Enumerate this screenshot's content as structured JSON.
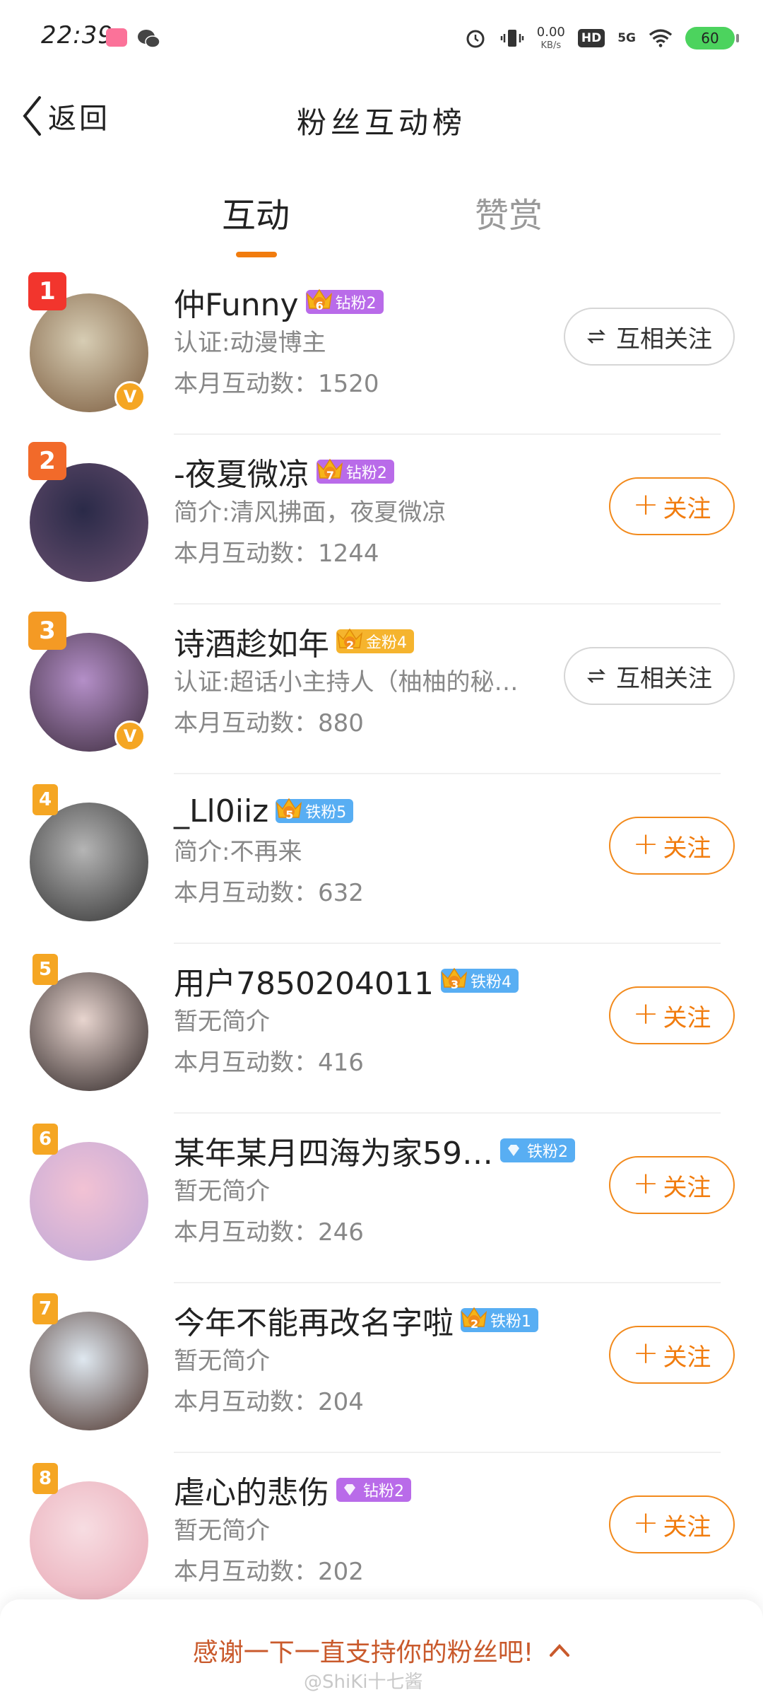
{
  "status_bar": {
    "time": "22:39",
    "net_speed_value": "0.00",
    "net_speed_unit": "KB/s",
    "hd": "HD",
    "signal": "5G",
    "battery": "60"
  },
  "header": {
    "back_label": "返回",
    "title": "粉丝互动榜"
  },
  "tabs": [
    {
      "label": "互动",
      "active": true
    },
    {
      "label": "赞赏",
      "active": false
    }
  ],
  "fans": [
    {
      "rank": "1",
      "name": "仲Funny",
      "badge_level": "6",
      "badge_label": "钻粉2",
      "badge_color": "#b96be9",
      "desc": "认证:动漫博主",
      "count": "本月互动数：1520",
      "button": "互相关注",
      "button_type": "mutual",
      "verified": true,
      "rank_color": "#f2352d",
      "avatar_colors": [
        "#d7cdb4",
        "#7a5a3c"
      ]
    },
    {
      "rank": "2",
      "name": "-夜夏微凉",
      "badge_level": "7",
      "badge_label": "钻粉2",
      "badge_color": "#b96be9",
      "desc": "简介:清风拂面，夜夏微凉",
      "count": "本月互动数：1244",
      "button": "关注",
      "button_type": "follow",
      "verified": false,
      "rank_color": "#f26a2a",
      "avatar_colors": [
        "#2a2a48",
        "#6a5070"
      ]
    },
    {
      "rank": "3",
      "name": "诗酒趁如年",
      "badge_level": "2",
      "badge_label": "金粉4",
      "badge_color": "#f5b42e",
      "desc": "认证:超话小主持人（柚柚的秘…",
      "count": "本月互动数：880",
      "button": "互相关注",
      "button_type": "mutual",
      "verified": true,
      "rank_color": "#f49a24",
      "avatar_colors": [
        "#b48fc8",
        "#3a2a3a"
      ]
    },
    {
      "rank": "4",
      "name": "_Ll0iiz",
      "badge_level": "5",
      "badge_label": "铁粉5",
      "badge_color": "#58aef3",
      "desc": "简介:不再来",
      "count": "本月互动数：632",
      "button": "关注",
      "button_type": "follow",
      "verified": false,
      "rank_color": "#f5a623",
      "avatar_colors": [
        "#b5b5b5",
        "#303030"
      ]
    },
    {
      "rank": "5",
      "name": "用户7850204011",
      "badge_level": "3",
      "badge_label": "铁粉4",
      "badge_color": "#58aef3",
      "desc": "暂无简介",
      "count": "本月互动数：416",
      "button": "关注",
      "button_type": "follow",
      "verified": false,
      "rank_color": "#f5a623",
      "avatar_colors": [
        "#e8d5cf",
        "#2a2222"
      ]
    },
    {
      "rank": "6",
      "name": "某年某月四海为家59…",
      "badge_level": "",
      "badge_label": "铁粉2",
      "badge_color": "#58aef3",
      "desc": "暂无简介",
      "count": "本月互动数：246",
      "button": "关注",
      "button_type": "follow",
      "verified": false,
      "rank_color": "#f5a623",
      "avatar_colors": [
        "#f2c2d4",
        "#bfa8d8"
      ]
    },
    {
      "rank": "7",
      "name": "今年不能再改名字啦",
      "badge_level": "2",
      "badge_label": "铁粉1",
      "badge_color": "#58aef3",
      "desc": "暂无简介",
      "count": "本月互动数：204",
      "button": "关注",
      "button_type": "follow",
      "verified": false,
      "rank_color": "#f5a623",
      "avatar_colors": [
        "#dfe8f0",
        "#4a3028"
      ]
    },
    {
      "rank": "8",
      "name": "虐心的悲伤",
      "badge_level": "",
      "badge_label": "钻粉2",
      "badge_color": "#b96be9",
      "desc": "暂无简介",
      "count": "本月互动数：202",
      "button": "关注",
      "button_type": "follow",
      "verified": false,
      "rank_color": "#f5a623",
      "avatar_colors": [
        "#f7dde2",
        "#e9a9b6"
      ]
    }
  ],
  "bottom": {
    "thanks": "感谢一下一直支持你的粉丝吧!",
    "watermark": "@ShiKi十七酱"
  },
  "colors": {
    "accent": "#f17c0e",
    "mutual_border": "#d6d6d6"
  }
}
